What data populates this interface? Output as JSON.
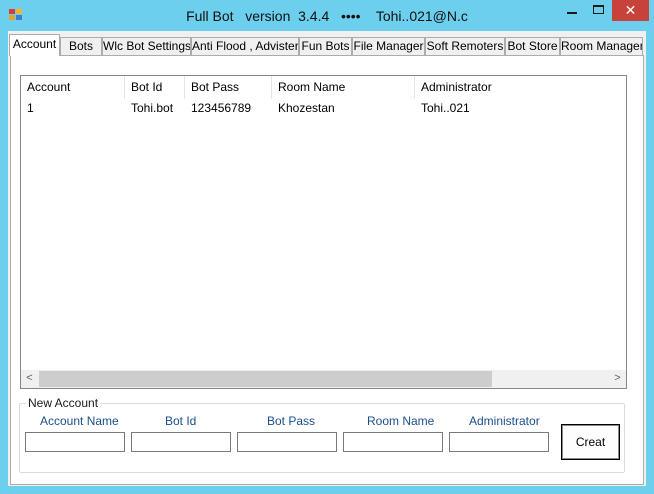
{
  "window": {
    "title": "Full Bot   version  3.4.4   ••••    Tohi..021@N.c",
    "close_glyph": "✕"
  },
  "tabs": [
    {
      "label": "Account",
      "active": true
    },
    {
      "label": "Bots"
    },
    {
      "label": "Wlc Bot Settings"
    },
    {
      "label": "Anti Flood , Advister"
    },
    {
      "label": "Fun Bots"
    },
    {
      "label": "File Manager"
    },
    {
      "label": "Soft Remoters"
    },
    {
      "label": "Bot Store"
    },
    {
      "label": "Room Manager"
    }
  ],
  "table": {
    "columns": [
      "Account",
      "Bot Id",
      "Bot Pass",
      "Room Name",
      "Administrator"
    ],
    "rows": [
      [
        "1",
        "Tohi.bot",
        "123456789",
        "Khozestan",
        "Tohi..021"
      ]
    ],
    "scroll_left_glyph": "<",
    "scroll_right_glyph": ">"
  },
  "new_account": {
    "group_title": "New Account",
    "fields": [
      {
        "label": "Account Name",
        "value": ""
      },
      {
        "label": "Bot Id",
        "value": ""
      },
      {
        "label": "Bot Pass",
        "value": ""
      },
      {
        "label": "Room Name",
        "value": ""
      },
      {
        "label": "Administrator",
        "value": ""
      }
    ],
    "create_button": "Creat"
  },
  "colors": {
    "title_bar": "#6dcfee",
    "close_button": "#c7423a",
    "label_blue": "#1a4f8a"
  }
}
